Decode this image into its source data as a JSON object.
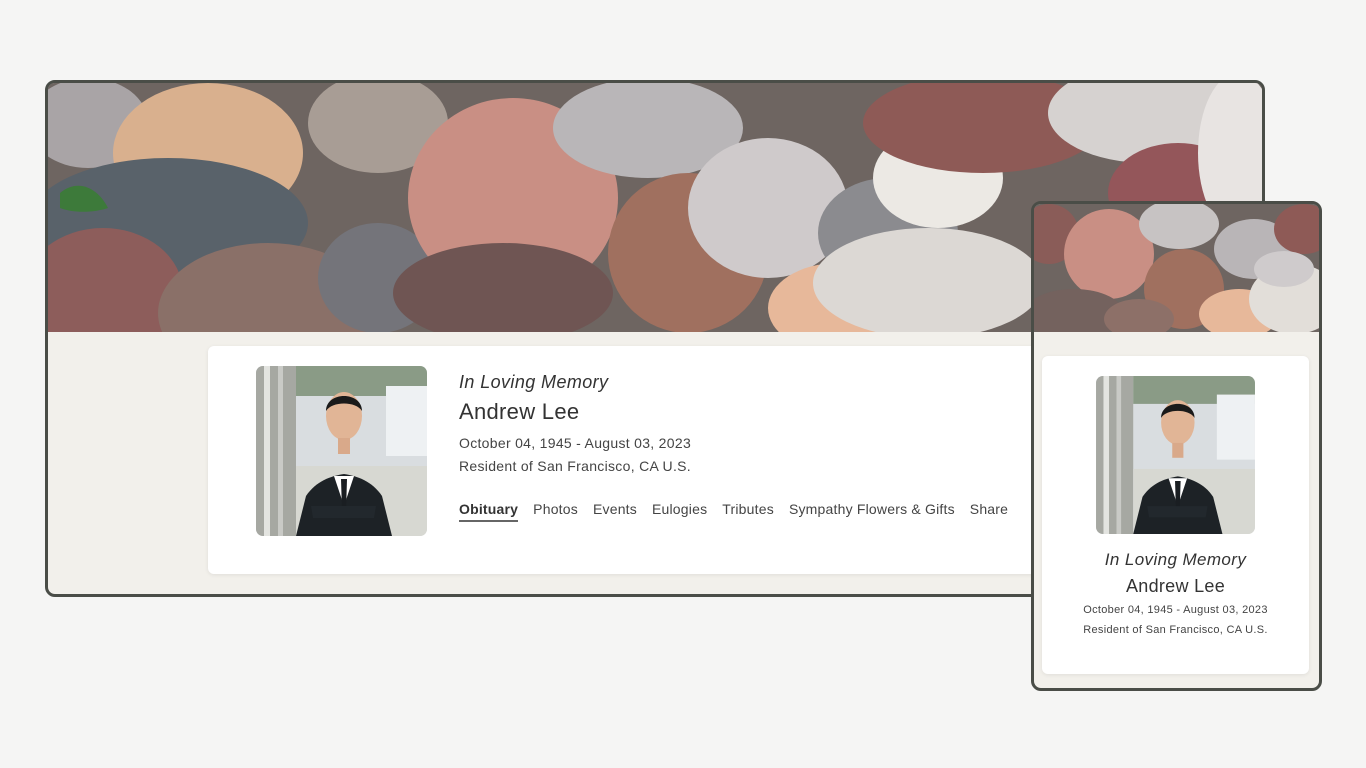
{
  "desktop": {
    "banner": {
      "description_icon": "pebbles-banner-image"
    },
    "profile": {
      "photo_icon": "portrait-photo",
      "heading": "In Loving Memory",
      "name": "Andrew Lee",
      "dates": "October 04, 1945 - August 03, 2023",
      "residence": "Resident of San Francisco, CA U.S."
    },
    "tabs": [
      {
        "label": "Obituary",
        "active": true
      },
      {
        "label": "Photos",
        "active": false
      },
      {
        "label": "Events",
        "active": false
      },
      {
        "label": "Eulogies",
        "active": false
      },
      {
        "label": "Tributes",
        "active": false
      },
      {
        "label": "Sympathy Flowers & Gifts",
        "active": false
      },
      {
        "label": "Share",
        "active": false
      }
    ]
  },
  "mobile": {
    "banner": {
      "description_icon": "pebbles-banner-image"
    },
    "profile": {
      "photo_icon": "portrait-photo",
      "heading": "In Loving Memory",
      "name": "Andrew Lee",
      "dates": "October 04, 1945 - August 03, 2023",
      "residence": "Resident of San Francisco, CA U.S."
    }
  },
  "colors": {
    "page_background": "#f5f5f4",
    "frame_border": "#4a4d47",
    "content_background": "#f2f0eb",
    "card_background": "#ffffff",
    "text": "#333333"
  }
}
